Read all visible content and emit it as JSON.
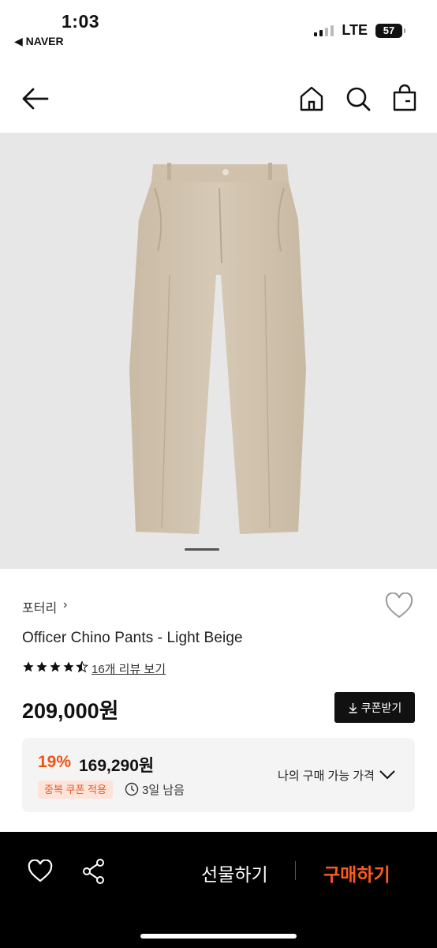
{
  "status": {
    "time": "1:03",
    "back_app": "◀ NAVER",
    "network": "LTE",
    "battery": "57"
  },
  "nav": {
    "icons": [
      "back-arrow-icon",
      "home-icon",
      "search-icon",
      "shopping-bag-icon"
    ]
  },
  "product": {
    "image_pages": 1,
    "brand": "포터리",
    "brand_chevron": "›",
    "title": "Officer Chino Pants - Light Beige",
    "rating_stars": 4.5,
    "reviews_link": "16개 리뷰 보기",
    "price": "209,000원",
    "coupon_button": "쿠폰받기"
  },
  "discount": {
    "percent": "19%",
    "price": "169,290원",
    "badge": "중복 쿠폰 적용",
    "remaining": "3일 남음",
    "my_price_label": "나의 구매 가능 가격"
  },
  "bottom": {
    "gift": "선물하기",
    "buy": "구매하기"
  },
  "colors": {
    "accent": "#f0520f",
    "badge_bg": "#fde3d8",
    "hero_bg": "#e7e7e7"
  }
}
